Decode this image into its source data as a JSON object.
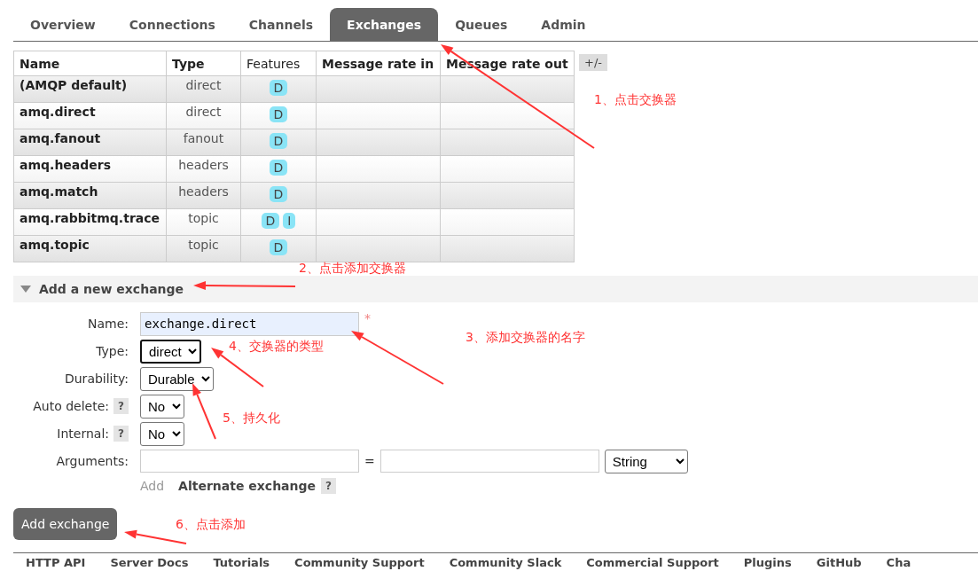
{
  "tabs": [
    {
      "label": "Overview",
      "selected": false
    },
    {
      "label": "Connections",
      "selected": false
    },
    {
      "label": "Channels",
      "selected": false
    },
    {
      "label": "Exchanges",
      "selected": true
    },
    {
      "label": "Queues",
      "selected": false
    },
    {
      "label": "Admin",
      "selected": false
    }
  ],
  "table": {
    "columns": [
      "Name",
      "Type",
      "Features",
      "Message rate in",
      "Message rate out"
    ],
    "toggle": "+/-",
    "rows": [
      {
        "name": "(AMQP default)",
        "type": "direct",
        "features": [
          "D"
        ]
      },
      {
        "name": "amq.direct",
        "type": "direct",
        "features": [
          "D"
        ]
      },
      {
        "name": "amq.fanout",
        "type": "fanout",
        "features": [
          "D"
        ]
      },
      {
        "name": "amq.headers",
        "type": "headers",
        "features": [
          "D"
        ]
      },
      {
        "name": "amq.match",
        "type": "headers",
        "features": [
          "D"
        ]
      },
      {
        "name": "amq.rabbitmq.trace",
        "type": "topic",
        "features": [
          "D",
          "I"
        ]
      },
      {
        "name": "amq.topic",
        "type": "topic",
        "features": [
          "D"
        ]
      }
    ]
  },
  "add_section": {
    "title": "Add a new exchange",
    "expanded": true,
    "fields": [
      {
        "kind": "text",
        "label": "Name:",
        "value": "exchange.direct",
        "required_mark": "*"
      },
      {
        "kind": "select",
        "label": "Type:",
        "value": "direct",
        "focused": true
      },
      {
        "kind": "select",
        "label": "Durability:",
        "value": "Durable",
        "focused": false
      },
      {
        "kind": "select",
        "label": "Auto delete:",
        "help": "?",
        "value": "No",
        "focused": false
      },
      {
        "kind": "select",
        "label": "Internal:",
        "help": "?",
        "value": "No",
        "focused": false
      },
      {
        "kind": "arguments",
        "label": "Arguments:",
        "equals": "=",
        "value_type": "String"
      }
    ],
    "add_link": "Add",
    "alternate": "Alternate exchange",
    "alternate_help": "?",
    "button": "Add exchange"
  },
  "footer": [
    "HTTP API",
    "Server Docs",
    "Tutorials",
    "Community Support",
    "Community Slack",
    "Commercial Support",
    "Plugins",
    "GitHub",
    "Cha"
  ],
  "annotations": [
    {
      "text": "1、点击交换器"
    },
    {
      "text": "2、点击添加交换器"
    },
    {
      "text": "3、添加交换器的名字"
    },
    {
      "text": "4、交换器的类型"
    },
    {
      "text": "5、持久化"
    },
    {
      "text": "6、点击添加"
    }
  ]
}
